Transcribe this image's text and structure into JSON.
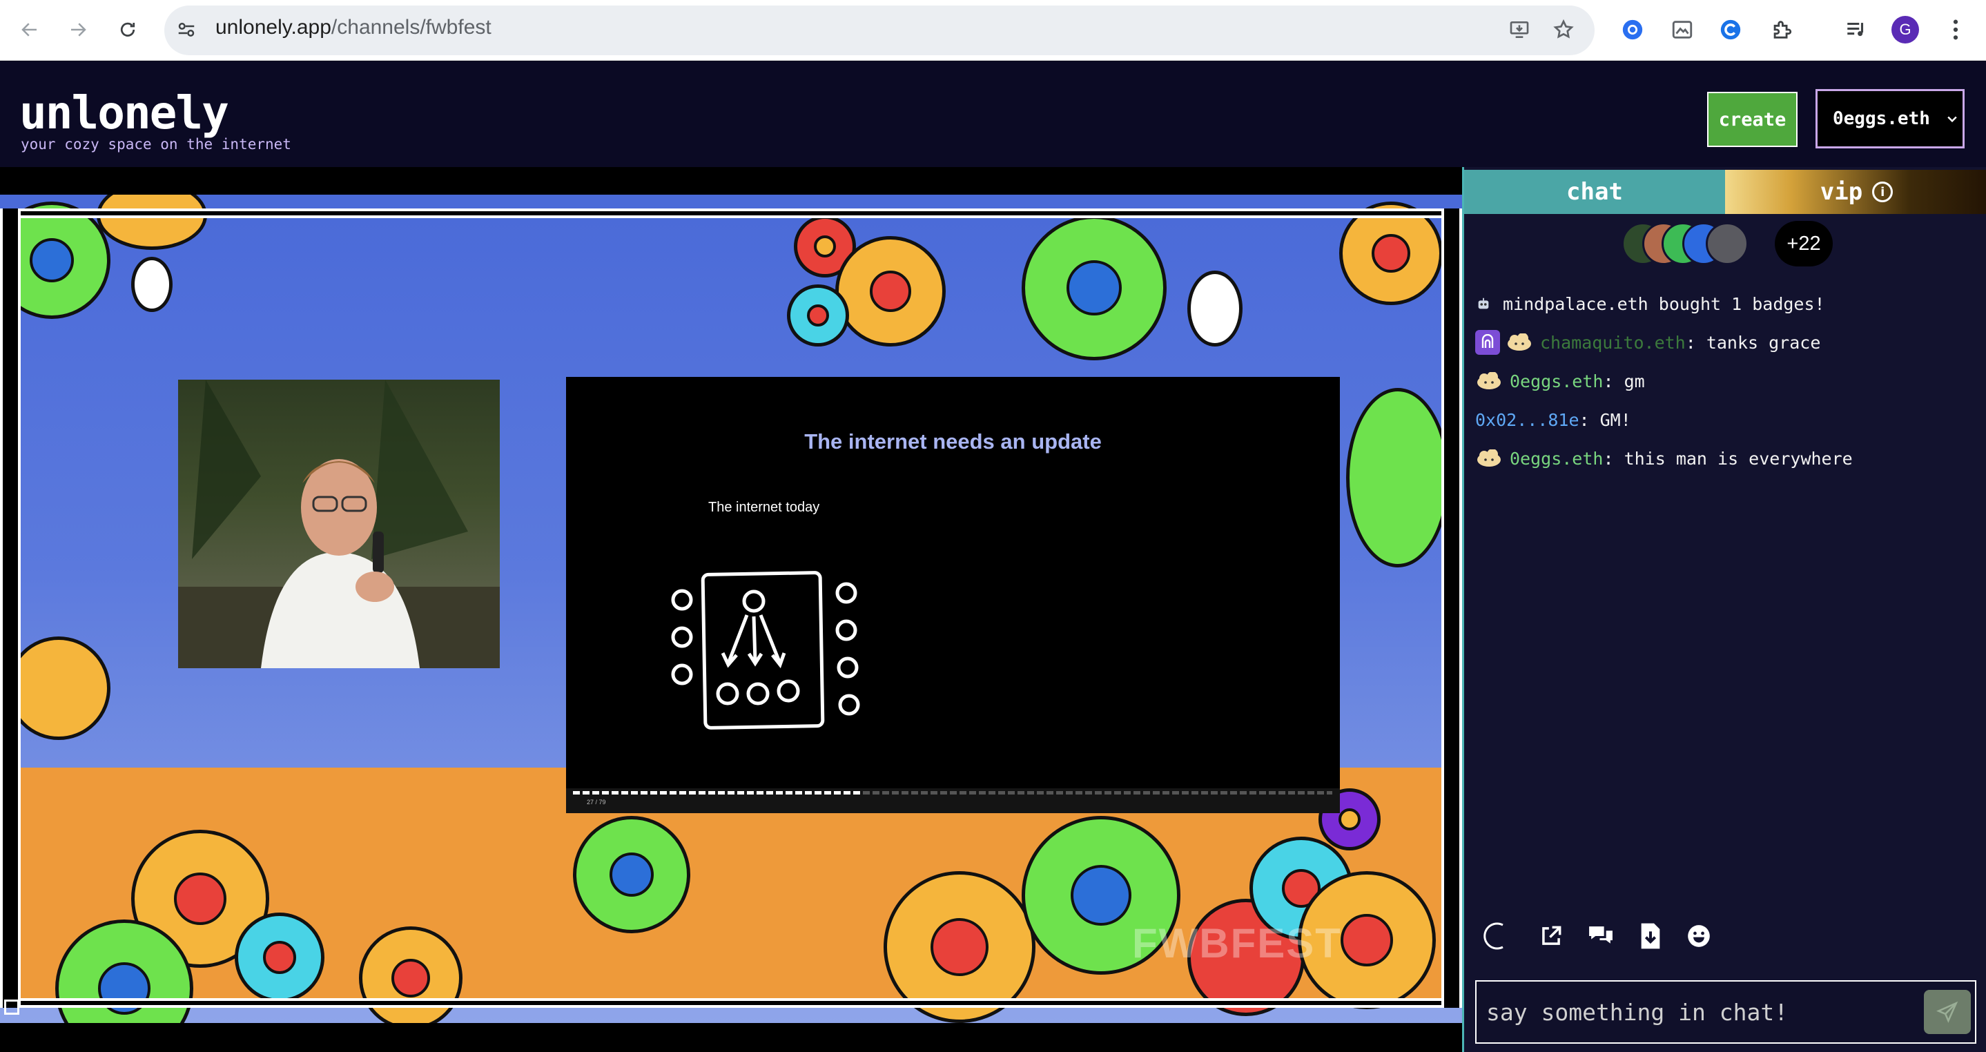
{
  "browser": {
    "url_domain": "unlonely.app",
    "url_path": "/channels/fwbfest",
    "profile_initial": "G"
  },
  "app": {
    "logo": "unlonely",
    "tagline": "your cozy space on the internet",
    "create_label": "create",
    "user_label": "0eggs.eth"
  },
  "stream": {
    "slide_title": "The internet needs an update",
    "slide_subtitle": "The internet today",
    "page_indicator": "27 / 79",
    "slide_progress": 0.38,
    "watermark": "FWBFEST"
  },
  "chat": {
    "tab_chat": "chat",
    "tab_vip": "vip",
    "info_glyph": "i",
    "viewer_more": "+22",
    "messages": [
      {
        "user": "",
        "text": "mindpalace.eth bought 1 badges!"
      },
      {
        "user": "chamaquito.eth",
        "text": ": tanks grace"
      },
      {
        "user": "0eggs.eth",
        "text": ": gm"
      },
      {
        "user": "0x02...81e",
        "text": ": GM!"
      },
      {
        "user": "0eggs.eth",
        "text": ": this man is everywhere"
      }
    ],
    "input_placeholder": "say something in chat!"
  },
  "colors": {
    "create_green": "#4fa83d",
    "chat_tab": "#4ba6a6",
    "user_green": "#79d67f",
    "user_blue": "#5fa8f5"
  },
  "icons": [
    "back-icon",
    "forward-icon",
    "reload-icon",
    "site-info-icon",
    "install-icon",
    "star-icon",
    "extension-icon",
    "puzzle-icon",
    "media-icon",
    "menu-dots-icon",
    "chevron-down-icon",
    "info-icon",
    "robot-icon",
    "popout-icon",
    "chat-bubbles-icon",
    "download-icon",
    "emoji-icon",
    "send-icon"
  ]
}
